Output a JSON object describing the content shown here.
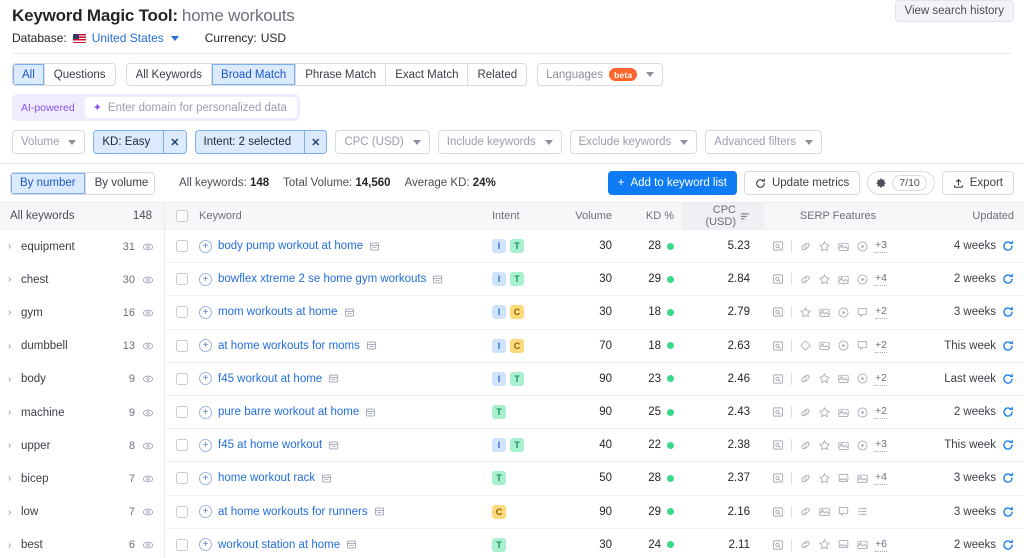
{
  "header": {
    "title": "Keyword Magic Tool:",
    "keyword": "home workouts",
    "database_label": "Database:",
    "database_value": "United States",
    "currency_label": "Currency:",
    "currency_value": "USD",
    "view_history": "View search history"
  },
  "tabs": {
    "group1": [
      {
        "label": "All",
        "active": true
      },
      {
        "label": "Questions",
        "active": false
      }
    ],
    "group2": [
      {
        "label": "All Keywords",
        "active": false
      },
      {
        "label": "Broad Match",
        "active": true
      },
      {
        "label": "Phrase Match",
        "active": false
      },
      {
        "label": "Exact Match",
        "active": false
      },
      {
        "label": "Related",
        "active": false
      }
    ],
    "languages": {
      "label": "Languages",
      "badge": "beta"
    }
  },
  "ai": {
    "tag": "AI-powered",
    "placeholder": "Enter domain for personalized data"
  },
  "filters": [
    {
      "label": "Volume",
      "active": false,
      "removable": false
    },
    {
      "label": "KD: Easy",
      "active": true,
      "removable": true
    },
    {
      "label": "Intent: 2 selected",
      "active": true,
      "removable": true
    },
    {
      "label": "CPC (USD)",
      "active": false,
      "removable": false
    },
    {
      "label": "Include keywords",
      "active": false,
      "removable": false
    },
    {
      "label": "Exclude keywords",
      "active": false,
      "removable": false
    },
    {
      "label": "Advanced filters",
      "active": false,
      "removable": false
    }
  ],
  "toolbar": {
    "by_number": "By number",
    "by_volume": "By volume",
    "stats": [
      {
        "label": "All keywords:",
        "value": "148"
      },
      {
        "label": "Total Volume:",
        "value": "14,560"
      },
      {
        "label": "Average KD:",
        "value": "24%"
      }
    ],
    "add_to_list": "Add to keyword list",
    "update_metrics": "Update metrics",
    "quota": "7/10",
    "export": "Export"
  },
  "sidebar": {
    "head_label": "All keywords",
    "head_count": "148",
    "items": [
      {
        "name": "equipment",
        "count": "31"
      },
      {
        "name": "chest",
        "count": "30"
      },
      {
        "name": "gym",
        "count": "16"
      },
      {
        "name": "dumbbell",
        "count": "13"
      },
      {
        "name": "body",
        "count": "9"
      },
      {
        "name": "machine",
        "count": "9"
      },
      {
        "name": "upper",
        "count": "8"
      },
      {
        "name": "bicep",
        "count": "7"
      },
      {
        "name": "low",
        "count": "7"
      },
      {
        "name": "best",
        "count": "6"
      }
    ]
  },
  "table": {
    "columns": {
      "keyword": "Keyword",
      "intent": "Intent",
      "volume": "Volume",
      "kd": "KD %",
      "cpc": "CPC (USD)",
      "serp": "SERP Features",
      "updated": "Updated"
    },
    "rows": [
      {
        "keyword": "body pump workout at home",
        "intent": [
          "I",
          "T"
        ],
        "volume": "30",
        "kd": "28",
        "cpc": "5.23",
        "serp": [
          "preview",
          "sep",
          "link",
          "star",
          "image",
          "video"
        ],
        "more": "+3",
        "updated": "4 weeks"
      },
      {
        "keyword": "bowflex xtreme 2 se home gym workouts",
        "intent": [
          "I",
          "T"
        ],
        "volume": "30",
        "kd": "29",
        "cpc": "2.84",
        "serp": [
          "preview",
          "sep",
          "link",
          "star",
          "image",
          "video"
        ],
        "more": "+4",
        "updated": "2 weeks"
      },
      {
        "keyword": "mom workouts at home",
        "intent": [
          "I",
          "C"
        ],
        "volume": "30",
        "kd": "18",
        "cpc": "2.79",
        "serp": [
          "preview",
          "sep",
          "star",
          "image",
          "video",
          "comment"
        ],
        "more": "+2",
        "updated": "3 weeks"
      },
      {
        "keyword": "at home workouts for moms",
        "intent": [
          "I",
          "C"
        ],
        "volume": "70",
        "kd": "18",
        "cpc": "2.63",
        "serp": [
          "preview",
          "sep",
          "diamond",
          "image",
          "video",
          "comment"
        ],
        "more": "+2",
        "updated": "This week"
      },
      {
        "keyword": "f45 workout at home",
        "intent": [
          "I",
          "T"
        ],
        "volume": "90",
        "kd": "23",
        "cpc": "2.46",
        "serp": [
          "preview",
          "sep",
          "link",
          "star",
          "image",
          "video"
        ],
        "more": "+2",
        "updated": "Last week"
      },
      {
        "keyword": "pure barre workout at home",
        "intent": [
          "T"
        ],
        "volume": "90",
        "kd": "25",
        "cpc": "2.43",
        "serp": [
          "preview",
          "sep",
          "link",
          "star",
          "image",
          "video"
        ],
        "more": "+2",
        "updated": "2 weeks"
      },
      {
        "keyword": "f45 at home workout",
        "intent": [
          "I",
          "T"
        ],
        "volume": "40",
        "kd": "22",
        "cpc": "2.38",
        "serp": [
          "preview",
          "sep",
          "link",
          "star",
          "image",
          "video"
        ],
        "more": "+3",
        "updated": "This week"
      },
      {
        "keyword": "home workout rack",
        "intent": [
          "T"
        ],
        "volume": "50",
        "kd": "28",
        "cpc": "2.37",
        "serp": [
          "preview",
          "sep",
          "link",
          "star",
          "picture",
          "image"
        ],
        "more": "+4",
        "updated": "3 weeks"
      },
      {
        "keyword": "at home workouts for runners",
        "intent": [
          "C"
        ],
        "volume": "90",
        "kd": "29",
        "cpc": "2.16",
        "serp": [
          "preview",
          "sep",
          "link",
          "image",
          "comment",
          "list"
        ],
        "more": "",
        "updated": "3 weeks"
      },
      {
        "keyword": "workout station at home",
        "intent": [
          "T"
        ],
        "volume": "30",
        "kd": "24",
        "cpc": "2.11",
        "serp": [
          "preview",
          "sep",
          "link",
          "star",
          "picture",
          "image"
        ],
        "more": "+6",
        "updated": "2 weeks"
      }
    ]
  },
  "colors": {
    "accent": "#0f7bf4",
    "link": "#246edb",
    "kd_dot": "#3ad88a",
    "ai": "#8754ee",
    "beta": "#ff642d"
  }
}
